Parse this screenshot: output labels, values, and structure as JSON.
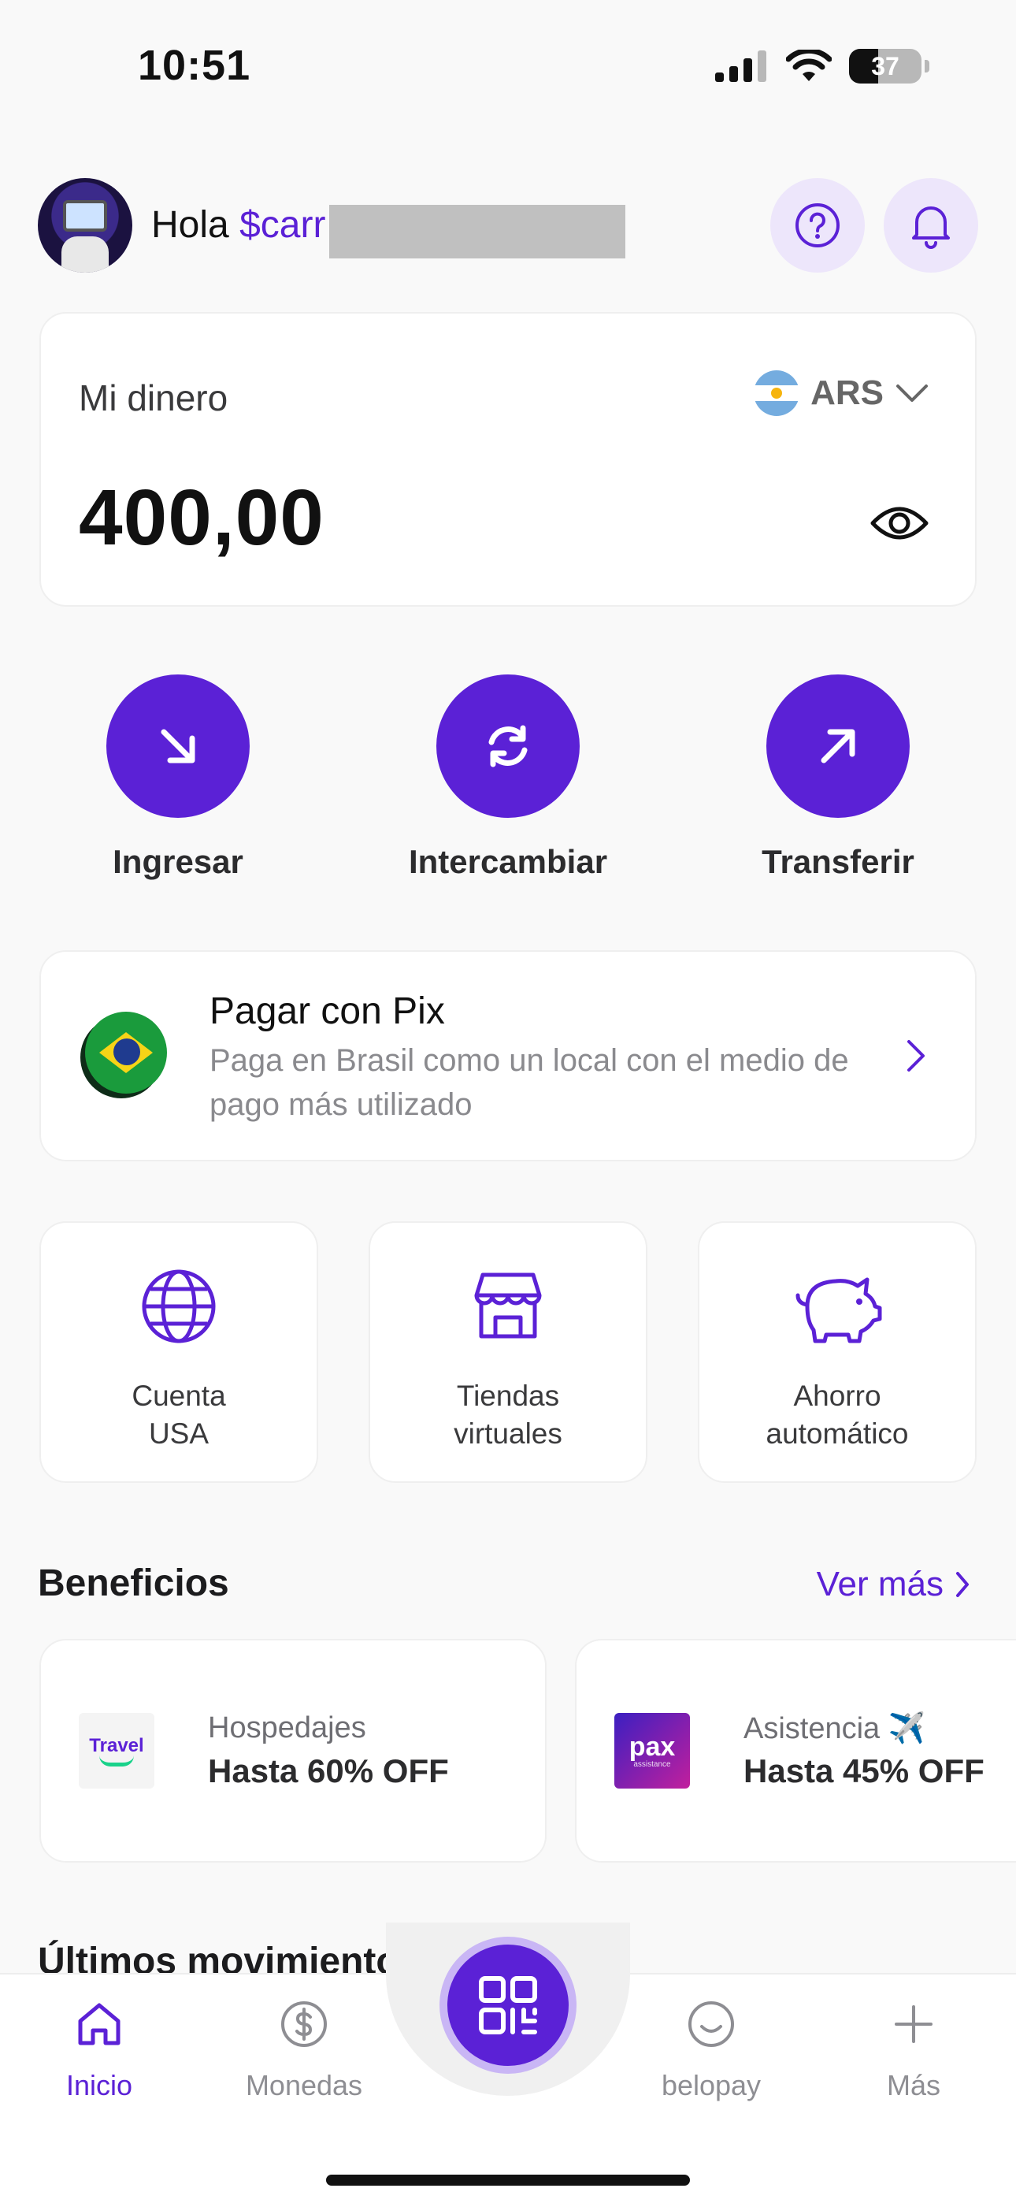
{
  "status_bar": {
    "time": "10:51",
    "battery": "37"
  },
  "header": {
    "greeting": "Hola",
    "username": "$carr"
  },
  "balance_card": {
    "label": "Mi dinero",
    "currency": "ARS",
    "amount": "400,00"
  },
  "actions": [
    {
      "label": "Ingresar",
      "icon": "arrow-down-right-icon"
    },
    {
      "label": "Intercambiar",
      "icon": "exchange-icon"
    },
    {
      "label": "Transferir",
      "icon": "arrow-up-right-icon"
    }
  ],
  "pix": {
    "title": "Pagar con Pix",
    "subtitle": "Paga en Brasil como un local con el medio de pago más utilizado"
  },
  "tiles": [
    {
      "line1": "Cuenta",
      "line2": "USA",
      "icon": "globe-icon"
    },
    {
      "line1": "Tiendas",
      "line2": "virtuales",
      "icon": "store-icon"
    },
    {
      "line1": "Ahorro",
      "line2": "automático",
      "icon": "piggy-bank-icon"
    }
  ],
  "benefits_section": {
    "title": "Beneficios",
    "see_more": "Ver más",
    "items": [
      {
        "logo_text": "Travel",
        "category": "Hospedajes",
        "offer": "Hasta 60% OFF"
      },
      {
        "logo_text": "pax",
        "logo_sub": "assistance",
        "category": "Asistencia ✈️",
        "offer": "Hasta 45% OFF"
      }
    ]
  },
  "movements_section": {
    "title": "Últimos movimientos"
  },
  "bottom_nav": [
    {
      "label": "Inicio",
      "icon": "home-icon",
      "active": true
    },
    {
      "label": "Monedas",
      "icon": "dollar-coin-icon",
      "active": false
    },
    {
      "label": "",
      "icon": "qr-icon",
      "active": false
    },
    {
      "label": "belopay",
      "icon": "smile-icon",
      "active": false
    },
    {
      "label": "Más",
      "icon": "plus-icon",
      "active": false
    }
  ],
  "colors": {
    "accent": "#5b21d6",
    "accent_light": "#ede6fb",
    "background": "#f9f9f9"
  }
}
